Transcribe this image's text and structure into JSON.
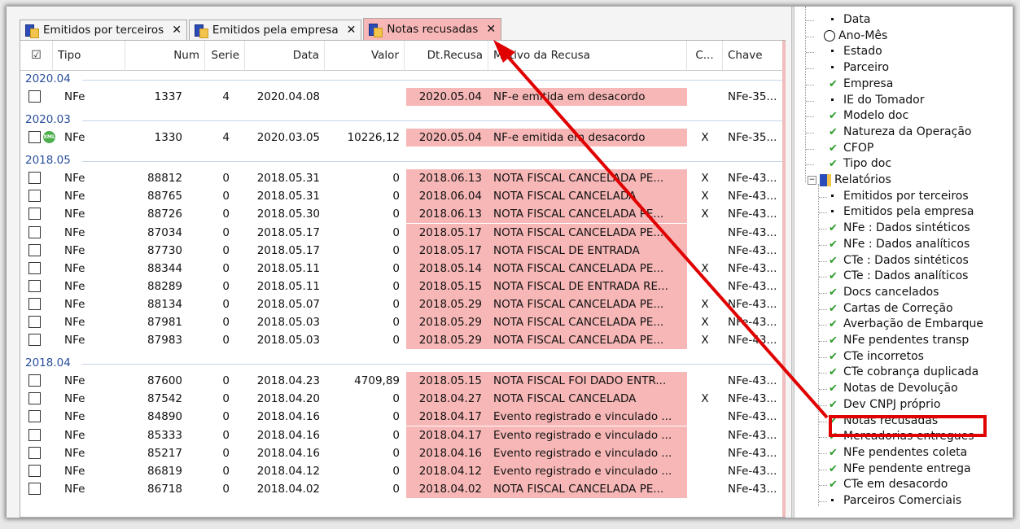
{
  "tabs": [
    {
      "label": "Emitidos por terceiros",
      "close": "✕",
      "active": false
    },
    {
      "label": "Emitidos pela empresa",
      "close": "✕",
      "active": false
    },
    {
      "label": "Notas recusadas",
      "close": "✕",
      "active": true
    }
  ],
  "columns": {
    "check": "☑",
    "tipo": "Tipo",
    "num": "Num",
    "serie": "Serie",
    "data": "Data",
    "valor": "Valor",
    "dtrecusa": "Dt.Recusa",
    "motivo": "Motivo da Recusa",
    "c": "C...",
    "chave": "Chave"
  },
  "groups": [
    {
      "label": "2020.04",
      "rows": [
        {
          "tipo": "NFe",
          "num": "1337",
          "serie": "4",
          "data": "2020.04.08",
          "valor": "",
          "dtrecusa": "2020.05.04",
          "motivo": "NF-e emitida em desacordo",
          "c": "",
          "chave": "NFe-35...",
          "xml": false
        }
      ]
    },
    {
      "label": "2020.03",
      "rows": [
        {
          "tipo": "NFe",
          "num": "1330",
          "serie": "4",
          "data": "2020.03.05",
          "valor": "10226,12",
          "dtrecusa": "2020.05.04",
          "motivo": "NF-e emitida em desacordo",
          "c": "X",
          "chave": "NFe-35...",
          "xml": true,
          "xml_label": "XML"
        }
      ]
    },
    {
      "label": "2018.05",
      "rows": [
        {
          "tipo": "NFe",
          "num": "88812",
          "serie": "0",
          "data": "2018.05.31",
          "valor": "0",
          "dtrecusa": "2018.06.13",
          "motivo": "NOTA FISCAL CANCELADA PE...",
          "c": "X",
          "chave": "NFe-43..."
        },
        {
          "tipo": "NFe",
          "num": "88765",
          "serie": "0",
          "data": "2018.05.31",
          "valor": "0",
          "dtrecusa": "2018.06.04",
          "motivo": "NOTA FISCAL CANCELADA",
          "c": "X",
          "chave": "NFe-43..."
        },
        {
          "tipo": "NFe",
          "num": "88726",
          "serie": "0",
          "data": "2018.05.30",
          "valor": "0",
          "dtrecusa": "2018.06.13",
          "motivo": "NOTA FISCAL CANCELADA PE...",
          "c": "X",
          "chave": "NFe-43..."
        },
        {
          "tipo": "NFe",
          "num": "87034",
          "serie": "0",
          "data": "2018.05.17",
          "valor": "0",
          "dtrecusa": "2018.05.17",
          "motivo": "NOTA FISCAL CANCELADA PE...",
          "c": "",
          "chave": "NFe-43..."
        },
        {
          "tipo": "NFe",
          "num": "87730",
          "serie": "0",
          "data": "2018.05.17",
          "valor": "0",
          "dtrecusa": "2018.05.17",
          "motivo": "NOTA FISCAL DE ENTRADA",
          "c": "",
          "chave": "NFe-43..."
        },
        {
          "tipo": "NFe",
          "num": "88344",
          "serie": "0",
          "data": "2018.05.11",
          "valor": "0",
          "dtrecusa": "2018.05.14",
          "motivo": "NOTA FISCAL CANCELADA PE...",
          "c": "X",
          "chave": "NFe-43..."
        },
        {
          "tipo": "NFe",
          "num": "88289",
          "serie": "0",
          "data": "2018.05.11",
          "valor": "0",
          "dtrecusa": "2018.05.15",
          "motivo": "NOTA FISCAL DE ENTRADA RE...",
          "c": "",
          "chave": "NFe-43..."
        },
        {
          "tipo": "NFe",
          "num": "88134",
          "serie": "0",
          "data": "2018.05.07",
          "valor": "0",
          "dtrecusa": "2018.05.29",
          "motivo": "NOTA FISCAL CANCELADA PE...",
          "c": "X",
          "chave": "NFe-43..."
        },
        {
          "tipo": "NFe",
          "num": "87981",
          "serie": "0",
          "data": "2018.05.03",
          "valor": "0",
          "dtrecusa": "2018.05.29",
          "motivo": "NOTA FISCAL CANCELADA PE...",
          "c": "X",
          "chave": "NFe-43..."
        },
        {
          "tipo": "NFe",
          "num": "87983",
          "serie": "0",
          "data": "2018.05.03",
          "valor": "0",
          "dtrecusa": "2018.05.29",
          "motivo": "NOTA FISCAL CANCELADA PE...",
          "c": "X",
          "chave": "NFe-43..."
        }
      ]
    },
    {
      "label": "2018.04",
      "rows": [
        {
          "tipo": "NFe",
          "num": "87600",
          "serie": "0",
          "data": "2018.04.23",
          "valor": "4709,89",
          "dtrecusa": "2018.05.15",
          "motivo": "NOTA FISCAL FOI DADO ENTR...",
          "c": "",
          "chave": "NFe-43..."
        },
        {
          "tipo": "NFe",
          "num": "87542",
          "serie": "0",
          "data": "2018.04.20",
          "valor": "0",
          "dtrecusa": "2018.04.27",
          "motivo": "NOTA FISCAL CANCELADA",
          "c": "X",
          "chave": "NFe-43..."
        },
        {
          "tipo": "NFe",
          "num": "84890",
          "serie": "0",
          "data": "2018.04.16",
          "valor": "0",
          "dtrecusa": "2018.04.17",
          "motivo": "Evento registrado e vinculado ...",
          "c": "",
          "chave": "NFe-43..."
        },
        {
          "tipo": "NFe",
          "num": "85333",
          "serie": "0",
          "data": "2018.04.16",
          "valor": "0",
          "dtrecusa": "2018.04.17",
          "motivo": "Evento registrado e vinculado ...",
          "c": "",
          "chave": "NFe-43..."
        },
        {
          "tipo": "NFe",
          "num": "85217",
          "serie": "0",
          "data": "2018.04.16",
          "valor": "0",
          "dtrecusa": "2018.04.16",
          "motivo": "Evento registrado e vinculado ...",
          "c": "",
          "chave": "NFe-43..."
        },
        {
          "tipo": "NFe",
          "num": "86819",
          "serie": "0",
          "data": "2018.04.12",
          "valor": "0",
          "dtrecusa": "2018.04.12",
          "motivo": "Evento registrado e vinculado ...",
          "c": "",
          "chave": "NFe-43..."
        },
        {
          "tipo": "NFe",
          "num": "86718",
          "serie": "0",
          "data": "2018.04.02",
          "valor": "0",
          "dtrecusa": "2018.04.02",
          "motivo": "NOTA FISCAL CANCELADA PE...",
          "c": "",
          "chave": "NFe-43..."
        }
      ]
    }
  ],
  "tree": [
    {
      "label": "Data",
      "mark": "dot",
      "indent": 1
    },
    {
      "label": "Ano-Mês",
      "mark": "clock",
      "indent": 1
    },
    {
      "label": "Estado",
      "mark": "dot",
      "indent": 1
    },
    {
      "label": "Parceiro",
      "mark": "dot",
      "indent": 1
    },
    {
      "label": "Empresa",
      "mark": "check",
      "indent": 1
    },
    {
      "label": "IE do Tomador",
      "mark": "dot",
      "indent": 1
    },
    {
      "label": "Modelo doc",
      "mark": "check",
      "indent": 1
    },
    {
      "label": "Natureza da Operação",
      "mark": "check",
      "indent": 1
    },
    {
      "label": "CFOP",
      "mark": "check",
      "indent": 1
    },
    {
      "label": "Tipo doc",
      "mark": "check",
      "indent": 1
    },
    {
      "label": "Relatórios",
      "mark": "folder",
      "indent": 0
    },
    {
      "label": "Emitidos por terceiros",
      "mark": "dot",
      "indent": 1
    },
    {
      "label": "Emitidos pela empresa",
      "mark": "dot",
      "indent": 1
    },
    {
      "label": "NFe : Dados sintéticos",
      "mark": "check",
      "indent": 1
    },
    {
      "label": "NFe : Dados analíticos",
      "mark": "check",
      "indent": 1
    },
    {
      "label": "CTe : Dados sintéticos",
      "mark": "check",
      "indent": 1
    },
    {
      "label": "CTe : Dados analíticos",
      "mark": "check",
      "indent": 1
    },
    {
      "label": "Docs cancelados",
      "mark": "check",
      "indent": 1
    },
    {
      "label": "Cartas de Correção",
      "mark": "check",
      "indent": 1
    },
    {
      "label": "Averbação de Embarque",
      "mark": "check",
      "indent": 1
    },
    {
      "label": "NFe pendentes transp",
      "mark": "check",
      "indent": 1
    },
    {
      "label": "CTe incorretos",
      "mark": "check",
      "indent": 1
    },
    {
      "label": "CTe cobrança duplicada",
      "mark": "check",
      "indent": 1
    },
    {
      "label": "Notas de Devolução",
      "mark": "check",
      "indent": 1
    },
    {
      "label": "Dev CNPJ próprio",
      "mark": "check",
      "indent": 1
    },
    {
      "label": "Notas recusadas",
      "mark": "check",
      "indent": 1,
      "highlighted": true
    },
    {
      "label": "Mercadorias entregues",
      "mark": "check",
      "indent": 1
    },
    {
      "label": "NFe pendentes coleta",
      "mark": "check",
      "indent": 1
    },
    {
      "label": "NFe pendente entrega",
      "mark": "check",
      "indent": 1
    },
    {
      "label": "CTe em desacordo",
      "mark": "check",
      "indent": 1
    },
    {
      "label": "Parceiros Comerciais",
      "mark": "dot",
      "indent": 1
    }
  ],
  "colors": {
    "highlight_pink": "#f8b7b7",
    "annotation_red": "#e00000",
    "group_blue": "#2a4f9c",
    "check_green": "#2c9d2c"
  }
}
